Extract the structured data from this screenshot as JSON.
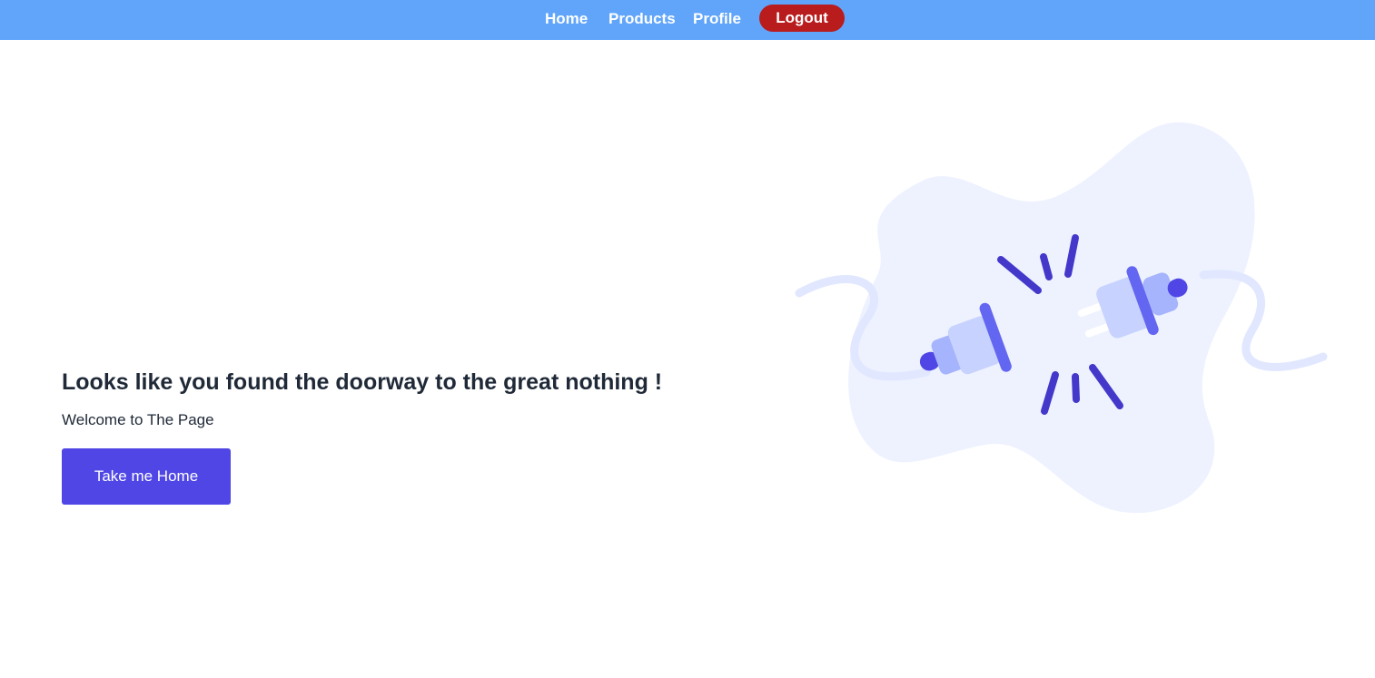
{
  "nav": {
    "home_label": "Home",
    "products_label": "Products",
    "profile_label": "Profile",
    "logout_label": "Logout"
  },
  "main": {
    "headline": "Looks like you found the doorway to the great nothing !",
    "subtext": "Welcome to The Page",
    "home_button_label": "Take me Home"
  },
  "illustration": {
    "icon": "unplugged-cable-icon"
  },
  "colors": {
    "navbar": "#60a5fa",
    "logout": "#b91c1c",
    "primary": "#4f46e5",
    "text": "#1f2937",
    "blob": "#eef2ff"
  }
}
